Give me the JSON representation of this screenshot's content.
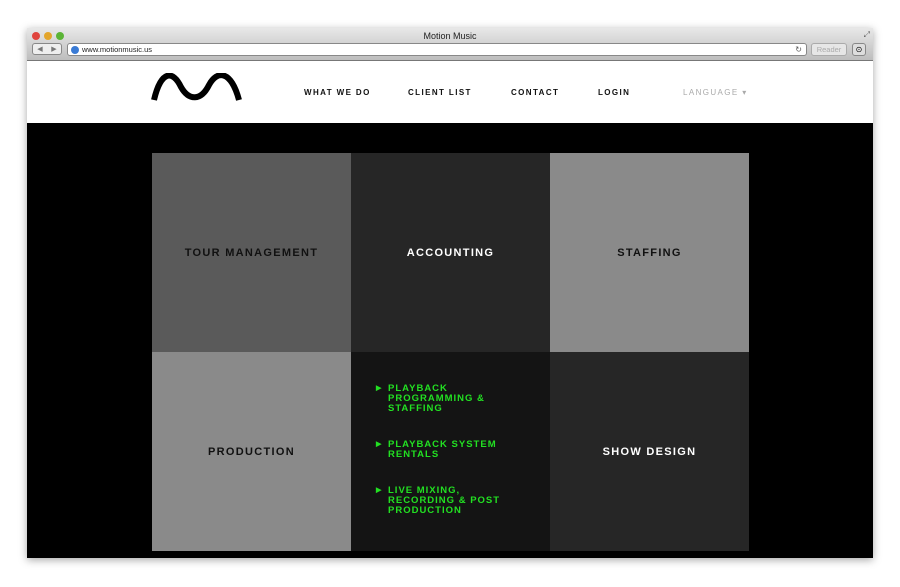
{
  "browser": {
    "title": "Motion Music",
    "url": "www.motionmusic.us",
    "reader": "Reader"
  },
  "nav": {
    "items": [
      "WHAT WE DO",
      "CLIENT LIST",
      "CONTACT",
      "LOGIN"
    ],
    "language": "LANGUAGE"
  },
  "tiles": [
    {
      "label": "TOUR MANAGEMENT",
      "bg": "#5a5a5a",
      "color": "#111111"
    },
    {
      "label": "ACCOUNTING",
      "bg": "#262626",
      "color": "#ffffff"
    },
    {
      "label": "STAFFING",
      "bg": "#8a8a8a",
      "color": "#111111"
    },
    {
      "label": "PRODUCTION",
      "bg": "#8a8a8a",
      "color": "#111111"
    },
    {
      "label": "SHOW DESIGN",
      "bg": "#262626",
      "color": "#ffffff"
    }
  ],
  "submenu": {
    "accent": "#22e022",
    "items": [
      "PLAYBACK PROGRAMMING & STAFFING",
      "PLAYBACK SYSTEM RENTALS",
      "LIVE MIXING, RECORDING & POST PRODUCTION"
    ]
  }
}
